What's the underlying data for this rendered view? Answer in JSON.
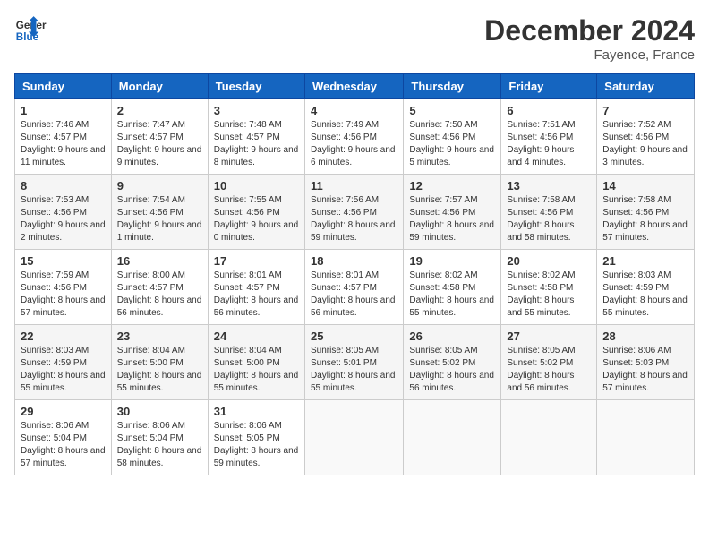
{
  "header": {
    "logo_line1": "General",
    "logo_line2": "Blue",
    "month_title": "December 2024",
    "location": "Fayence, France"
  },
  "weekdays": [
    "Sunday",
    "Monday",
    "Tuesday",
    "Wednesday",
    "Thursday",
    "Friday",
    "Saturday"
  ],
  "weeks": [
    [
      {
        "day": "1",
        "sunrise": "7:46 AM",
        "sunset": "4:57 PM",
        "daylight": "9 hours and 11 minutes."
      },
      {
        "day": "2",
        "sunrise": "7:47 AM",
        "sunset": "4:57 PM",
        "daylight": "9 hours and 9 minutes."
      },
      {
        "day": "3",
        "sunrise": "7:48 AM",
        "sunset": "4:57 PM",
        "daylight": "9 hours and 8 minutes."
      },
      {
        "day": "4",
        "sunrise": "7:49 AM",
        "sunset": "4:56 PM",
        "daylight": "9 hours and 6 minutes."
      },
      {
        "day": "5",
        "sunrise": "7:50 AM",
        "sunset": "4:56 PM",
        "daylight": "9 hours and 5 minutes."
      },
      {
        "day": "6",
        "sunrise": "7:51 AM",
        "sunset": "4:56 PM",
        "daylight": "9 hours and 4 minutes."
      },
      {
        "day": "7",
        "sunrise": "7:52 AM",
        "sunset": "4:56 PM",
        "daylight": "9 hours and 3 minutes."
      }
    ],
    [
      {
        "day": "8",
        "sunrise": "7:53 AM",
        "sunset": "4:56 PM",
        "daylight": "9 hours and 2 minutes."
      },
      {
        "day": "9",
        "sunrise": "7:54 AM",
        "sunset": "4:56 PM",
        "daylight": "9 hours and 1 minute."
      },
      {
        "day": "10",
        "sunrise": "7:55 AM",
        "sunset": "4:56 PM",
        "daylight": "9 hours and 0 minutes."
      },
      {
        "day": "11",
        "sunrise": "7:56 AM",
        "sunset": "4:56 PM",
        "daylight": "8 hours and 59 minutes."
      },
      {
        "day": "12",
        "sunrise": "7:57 AM",
        "sunset": "4:56 PM",
        "daylight": "8 hours and 59 minutes."
      },
      {
        "day": "13",
        "sunrise": "7:58 AM",
        "sunset": "4:56 PM",
        "daylight": "8 hours and 58 minutes."
      },
      {
        "day": "14",
        "sunrise": "7:58 AM",
        "sunset": "4:56 PM",
        "daylight": "8 hours and 57 minutes."
      }
    ],
    [
      {
        "day": "15",
        "sunrise": "7:59 AM",
        "sunset": "4:56 PM",
        "daylight": "8 hours and 57 minutes."
      },
      {
        "day": "16",
        "sunrise": "8:00 AM",
        "sunset": "4:57 PM",
        "daylight": "8 hours and 56 minutes."
      },
      {
        "day": "17",
        "sunrise": "8:01 AM",
        "sunset": "4:57 PM",
        "daylight": "8 hours and 56 minutes."
      },
      {
        "day": "18",
        "sunrise": "8:01 AM",
        "sunset": "4:57 PM",
        "daylight": "8 hours and 56 minutes."
      },
      {
        "day": "19",
        "sunrise": "8:02 AM",
        "sunset": "4:58 PM",
        "daylight": "8 hours and 55 minutes."
      },
      {
        "day": "20",
        "sunrise": "8:02 AM",
        "sunset": "4:58 PM",
        "daylight": "8 hours and 55 minutes."
      },
      {
        "day": "21",
        "sunrise": "8:03 AM",
        "sunset": "4:59 PM",
        "daylight": "8 hours and 55 minutes."
      }
    ],
    [
      {
        "day": "22",
        "sunrise": "8:03 AM",
        "sunset": "4:59 PM",
        "daylight": "8 hours and 55 minutes."
      },
      {
        "day": "23",
        "sunrise": "8:04 AM",
        "sunset": "5:00 PM",
        "daylight": "8 hours and 55 minutes."
      },
      {
        "day": "24",
        "sunrise": "8:04 AM",
        "sunset": "5:00 PM",
        "daylight": "8 hours and 55 minutes."
      },
      {
        "day": "25",
        "sunrise": "8:05 AM",
        "sunset": "5:01 PM",
        "daylight": "8 hours and 55 minutes."
      },
      {
        "day": "26",
        "sunrise": "8:05 AM",
        "sunset": "5:02 PM",
        "daylight": "8 hours and 56 minutes."
      },
      {
        "day": "27",
        "sunrise": "8:05 AM",
        "sunset": "5:02 PM",
        "daylight": "8 hours and 56 minutes."
      },
      {
        "day": "28",
        "sunrise": "8:06 AM",
        "sunset": "5:03 PM",
        "daylight": "8 hours and 57 minutes."
      }
    ],
    [
      {
        "day": "29",
        "sunrise": "8:06 AM",
        "sunset": "5:04 PM",
        "daylight": "8 hours and 57 minutes."
      },
      {
        "day": "30",
        "sunrise": "8:06 AM",
        "sunset": "5:04 PM",
        "daylight": "8 hours and 58 minutes."
      },
      {
        "day": "31",
        "sunrise": "8:06 AM",
        "sunset": "5:05 PM",
        "daylight": "8 hours and 59 minutes."
      },
      null,
      null,
      null,
      null
    ]
  ]
}
